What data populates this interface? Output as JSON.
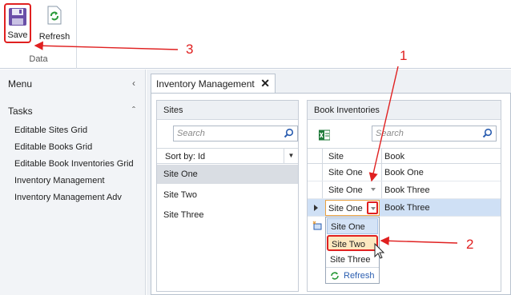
{
  "ribbon": {
    "save_label": "Save",
    "refresh_label": "Refresh",
    "group_label": "Data"
  },
  "nav": {
    "menu_label": "Menu",
    "menu_chevron": "‹",
    "tasks_label": "Tasks",
    "tasks_chevron": "ˆ",
    "items": [
      {
        "label": "Editable Sites Grid"
      },
      {
        "label": "Editable Books Grid"
      },
      {
        "label": "Editable Book Inventories Grid"
      },
      {
        "label": "Inventory Management"
      },
      {
        "label": "Inventory Management Adv"
      }
    ]
  },
  "tab": {
    "title": "Inventory Management",
    "close": "✕"
  },
  "sites": {
    "header": "Sites",
    "search_placeholder": "Search",
    "sort_label": "Sort by: Id",
    "rows": [
      {
        "name": "Site One"
      },
      {
        "name": "Site Two"
      },
      {
        "name": "Site Three"
      }
    ]
  },
  "book_inventories": {
    "header": "Book Inventories",
    "search_placeholder": "Search",
    "col_site": "Site",
    "col_book": "Book",
    "rows": [
      {
        "site": "Site One",
        "book": "Book One"
      },
      {
        "site": "Site One",
        "book": "Book Three"
      },
      {
        "site": "Site One",
        "book": "Book Three"
      }
    ],
    "dropdown_options": [
      "Site One",
      "Site Two",
      "Site Three"
    ],
    "dropdown_refresh": "Refresh"
  },
  "callouts": {
    "one": "1",
    "two": "2",
    "three": "3"
  },
  "colors": {
    "accent_red": "#e02020",
    "selection": "#cfe0f5",
    "link_blue": "#2a5db0"
  }
}
